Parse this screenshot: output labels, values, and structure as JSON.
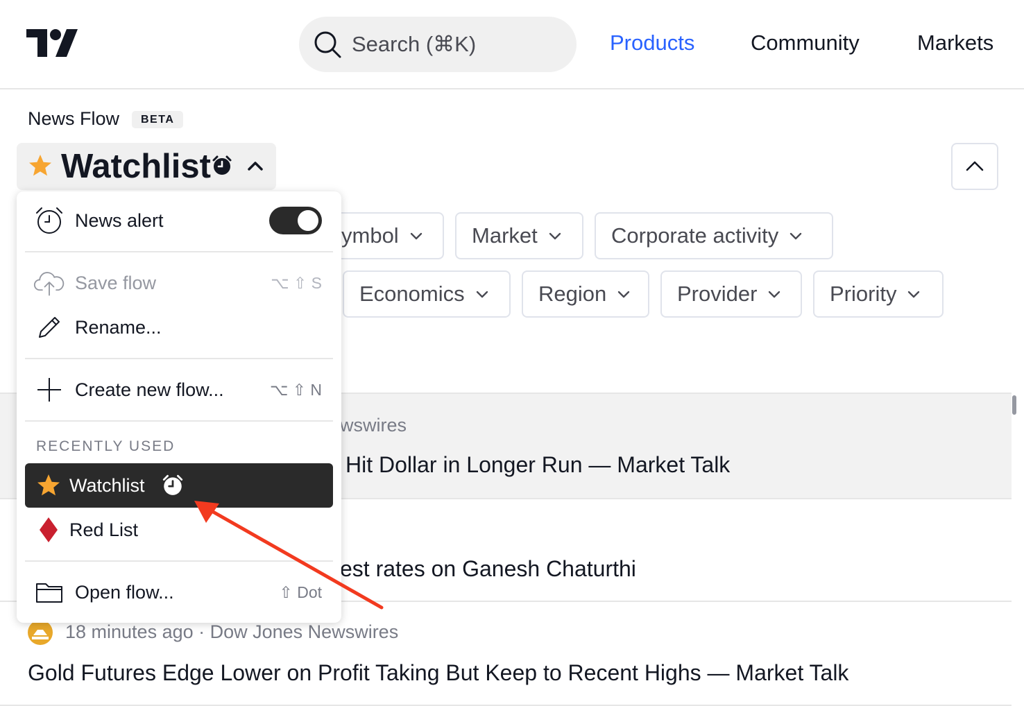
{
  "header": {
    "search_placeholder": "Search (⌘K)",
    "nav": [
      {
        "label": "Products",
        "active": true
      },
      {
        "label": "Community",
        "active": false
      },
      {
        "label": "Markets",
        "active": false
      }
    ],
    "active_color": "#2962ff"
  },
  "page": {
    "section_label": "News Flow",
    "beta_badge": "BETA",
    "current_flow": "Watchlist"
  },
  "filters": [
    {
      "label": "ymbol"
    },
    {
      "label": "Market"
    },
    {
      "label": "Corporate activity"
    },
    {
      "label": "Economics"
    },
    {
      "label": "Region"
    },
    {
      "label": "Provider"
    },
    {
      "label": "Priority"
    }
  ],
  "news": [
    {
      "meta": "wswires",
      "headline": "Hit Dollar in Longer Run — Market Talk",
      "highlight": true
    },
    {
      "meta": "",
      "headline": "est rates on Ganesh Chaturthi",
      "highlight": false
    },
    {
      "meta": "18 minutes ago · Dow Jones Newswires",
      "headline": "Gold Futures Edge Lower on Profit Taking But Keep to Recent Highs — Market Talk",
      "highlight": false
    }
  ],
  "menu": {
    "news_alert": {
      "label": "News alert",
      "enabled": true
    },
    "save_flow": {
      "label": "Save flow",
      "shortcut": "⌥ ⇧ S",
      "disabled": true
    },
    "rename": {
      "label": "Rename..."
    },
    "create_new": {
      "label": "Create new flow...",
      "shortcut": "⌥ ⇧ N"
    },
    "recently_used_heading": "RECENTLY USED",
    "recent": [
      {
        "label": "Watchlist",
        "icon": "star-icon",
        "selected": true
      },
      {
        "label": "Red List",
        "icon": "diamond-icon",
        "selected": false
      }
    ],
    "open_flow": {
      "label": "Open flow...",
      "shortcut": "⇧ Dot"
    }
  },
  "colors": {
    "star": "#f7a531",
    "diamond": "#c9202f",
    "annotation_arrow": "#f23a1f"
  }
}
